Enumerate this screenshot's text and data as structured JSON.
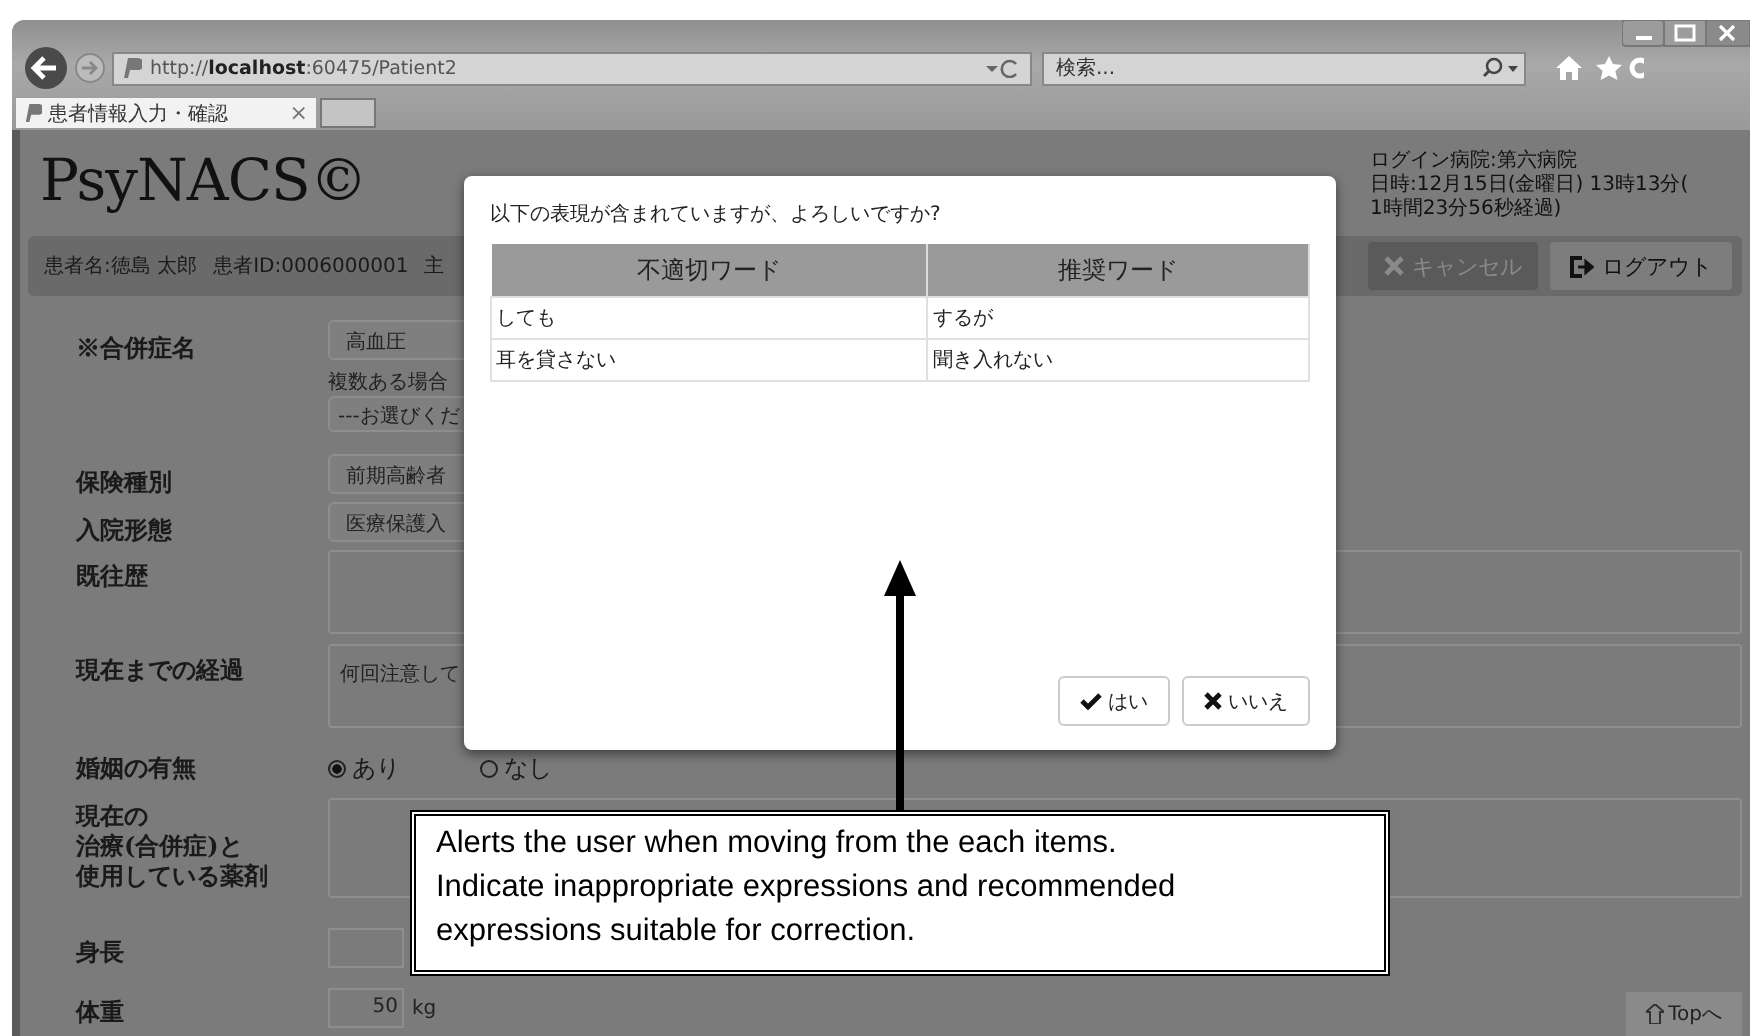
{
  "browser": {
    "address": "http://**localhost**:60475/Patient2",
    "search_placeholder": "検索...",
    "tabs": [
      {
        "title": "患者情報入力・確認",
        "close": "×",
        "selected": true
      }
    ]
  },
  "header": {
    "logo": "PsyNACS©",
    "login_info": [
      "ログイン病院:第六病院",
      "日時:12月15日(金曜日) 13時13分(",
      "1時間23分56秒経過)"
    ]
  },
  "patient_bar": {
    "name": "患者名:徳島 太郎",
    "id": "患者ID:0006000001",
    "cut": "主",
    "buttons": [
      {
        "label": "キャンセル",
        "kind": "cancel",
        "disabled": true
      },
      {
        "label": "ログアウト",
        "kind": "logout",
        "disabled": false
      }
    ]
  },
  "form": {
    "rows": [
      {
        "kind": "select",
        "label": "※合併症名",
        "value": "高血圧"
      },
      {
        "kind": "note_select",
        "note": "複数ある場合",
        "value": "---お選びくだ"
      },
      {
        "kind": "select",
        "label": "保険種別",
        "value": "前期高齢者"
      },
      {
        "kind": "select",
        "label": "入院形態",
        "value": "医療保護入"
      },
      {
        "kind": "textarea",
        "label": "既往歴"
      },
      {
        "kind": "textarea",
        "label": "現在までの経過",
        "value": "何回注意して"
      },
      {
        "kind": "radio",
        "label": "婚姻の有無",
        "options": [
          {
            "label": "あり",
            "selected": true
          },
          {
            "label": "なし",
            "selected": false
          }
        ]
      },
      {
        "kind": "textarea",
        "label_lines": [
          "現在の",
          "治療(合併症)と",
          "使用している薬剤"
        ]
      },
      {
        "kind": "number",
        "label": "身長"
      },
      {
        "kind": "number",
        "label": "体重",
        "value": "50",
        "unit": "kg"
      }
    ]
  },
  "top_button": "Topへ",
  "dialog": {
    "message": "以下の表現が含まれていますが、よろしいですか?",
    "columns": [
      "不適切ワード",
      "推奨ワード"
    ],
    "rows": [
      [
        "しても",
        "するが"
      ],
      [
        "耳を貸さない",
        "聞き入れない"
      ]
    ],
    "buttons": [
      {
        "label": "はい",
        "kind": "ok"
      },
      {
        "label": "いいえ",
        "kind": "cancel"
      }
    ]
  },
  "annotation": {
    "lines": [
      "Alerts the user when moving from the each items.",
      "Indicate inappropriate expressions and recommended",
      "expressions suitable for correction."
    ]
  }
}
